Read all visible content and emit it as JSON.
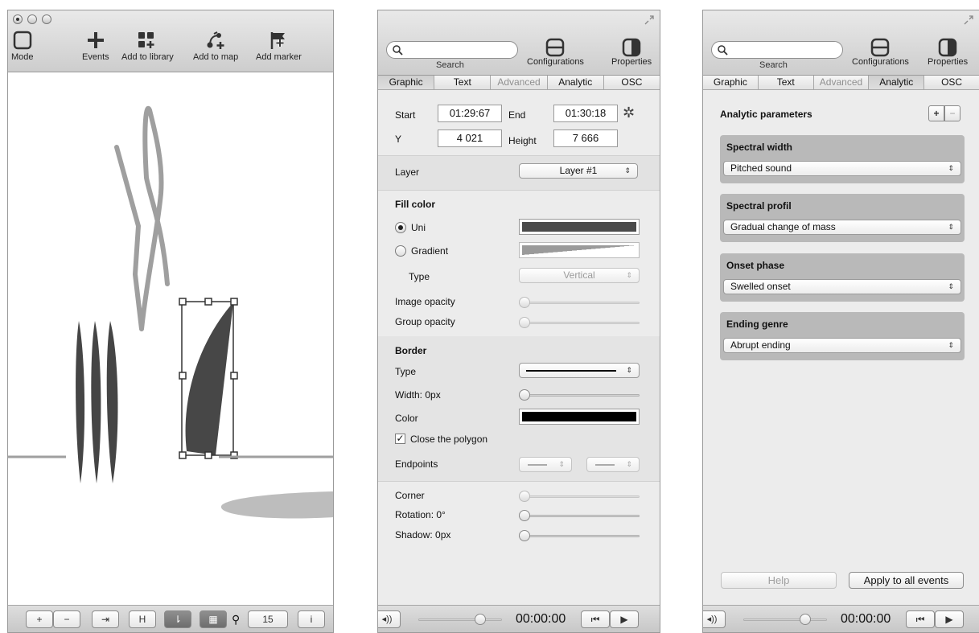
{
  "window1": {
    "toolbar": [
      {
        "label": "Mode",
        "icon": "square-icon"
      },
      {
        "label": "Events",
        "icon": "plus-icon"
      },
      {
        "label": "Add to library",
        "icon": "library-icon"
      },
      {
        "label": "Add to map",
        "icon": "map-icon"
      },
      {
        "label": "Add marker",
        "icon": "flag-icon"
      }
    ],
    "bottombar": {
      "zoom_value": "15",
      "info_label": "i",
      "plus": "+",
      "minus": "−"
    }
  },
  "window2": {
    "search": {
      "label": "Search",
      "placeholder": ""
    },
    "buttons": {
      "configurations": "Configurations",
      "properties": "Properties"
    },
    "tabs": [
      "Graphic",
      "Text",
      "Advanced",
      "Analytic",
      "OSC"
    ],
    "selected_tab": "Graphic",
    "disabled_tab": "Advanced",
    "position": {
      "start_label": "Start",
      "start_value": "01:29:67",
      "end_label": "End",
      "end_value": "01:30:18",
      "y_label": "Y",
      "y_value": "4 021",
      "height_label": "Height",
      "height_value": "7 666"
    },
    "layer": {
      "label": "Layer",
      "value": "Layer #1"
    },
    "fill": {
      "title": "Fill color",
      "uni_label": "Uni",
      "uni_selected": true,
      "uni_color": "#4a4a4a",
      "gradient_label": "Gradient",
      "type_label": "Type",
      "type_value": "Vertical",
      "image_opacity_label": "Image opacity",
      "image_opacity": 0,
      "group_opacity_label": "Group opacity",
      "group_opacity": 0
    },
    "border": {
      "title": "Border",
      "type_label": "Type",
      "width_label": "Width:  0px",
      "width": 0,
      "color_label": "Color",
      "color": "#000000",
      "close_polygon_label": "Close the polygon",
      "close_polygon": true,
      "endpoints_label": "Endpoints"
    },
    "misc": {
      "corner_label": "Corner",
      "corner": 0,
      "rotation_label": "Rotation:  0°",
      "rotation": 0,
      "shadow_label": "Shadow:  0px",
      "shadow": 0
    },
    "bottombar": {
      "time": "00:00:00",
      "volume": 0.5
    }
  },
  "window3": {
    "search": {
      "label": "Search"
    },
    "buttons": {
      "configurations": "Configurations",
      "properties": "Properties"
    },
    "tabs": [
      "Graphic",
      "Text",
      "Advanced",
      "Analytic",
      "OSC"
    ],
    "selected_tab": "Analytic",
    "title": "Analytic parameters",
    "add_label": "+",
    "remove_label": "−",
    "groups": [
      {
        "title": "Spectral width",
        "value": "Pitched sound"
      },
      {
        "title": "Spectral profil",
        "value": "Gradual change of mass"
      },
      {
        "title": "Onset phase",
        "value": "Swelled onset"
      },
      {
        "title": "Ending genre",
        "value": "Abrupt ending"
      }
    ],
    "help_label": "Help",
    "apply_label": "Apply to all events",
    "bottombar": {
      "time": "00:00:00",
      "volume": 0.5
    }
  }
}
